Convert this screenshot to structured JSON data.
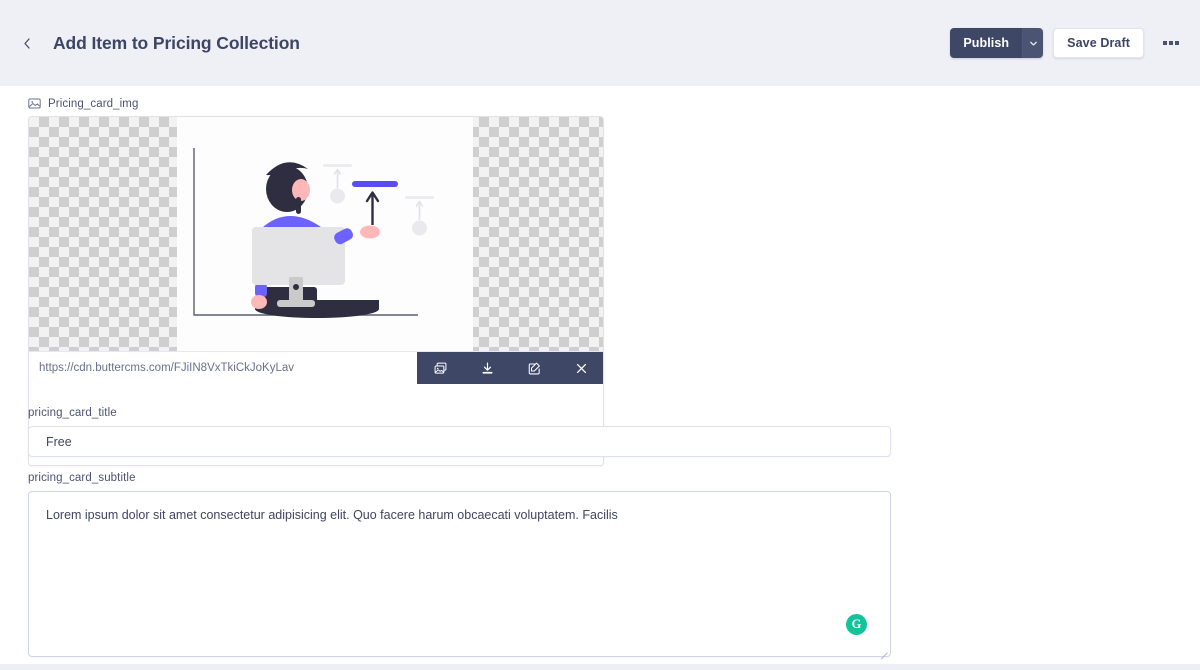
{
  "header": {
    "back_icon": "chevron-left-icon",
    "title": "Add Item to Pricing Collection",
    "publish_label": "Publish",
    "publish_caret_icon": "chevron-down-icon",
    "save_draft_label": "Save Draft",
    "more_menu_icon": "ellipsis-icon",
    "background_color": "#eff0f5",
    "accent_color": "#3f4766"
  },
  "fields": {
    "image": {
      "label": "Pricing_card_img",
      "label_icon": "image-icon",
      "url_value": "https://cdn.buttercms.com/FJiIN8VxTkiCkJoKyLav",
      "url_placeholder": "Image URL",
      "toolbar": [
        {
          "name": "copy-image-button",
          "icon": "images-stack-icon"
        },
        {
          "name": "download-image-button",
          "icon": "download-icon"
        },
        {
          "name": "edit-image-button",
          "icon": "pencil-square-icon"
        },
        {
          "name": "remove-image-button",
          "icon": "close-icon"
        }
      ],
      "toolbar_color": "#3f4766"
    },
    "title": {
      "label": "pricing_card_title",
      "value": "Free",
      "placeholder": ""
    },
    "subtitle": {
      "label": "pricing_card_subtitle",
      "value": "Lorem ipsum dolor sit amet consectetur adipisicing elit. Quo facere harum obcaecati voluptatem. Facilis",
      "placeholder": "",
      "assistant_badge": "G",
      "assistant_badge_color": "#15c39a"
    }
  }
}
